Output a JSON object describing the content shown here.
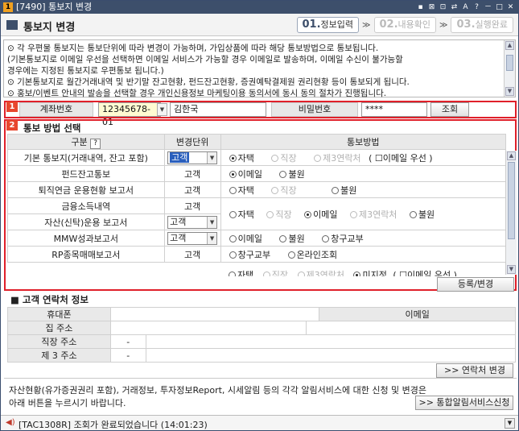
{
  "window": {
    "app_icon": "1",
    "title": "[7490] 통보지 변경",
    "controls": [
      "▪",
      "⊠",
      "⊡",
      "⇄",
      "A",
      "?",
      "－",
      "□",
      "✕"
    ]
  },
  "header": {
    "title": "통보지 변경",
    "steps": [
      {
        "num": "01.",
        "label": "정보입력",
        "active": true
      },
      {
        "num": "02.",
        "label": "내용확인",
        "active": false
      },
      {
        "num": "03.",
        "label": "실행완료",
        "active": false
      }
    ],
    "step_arrow": "≫"
  },
  "notice": {
    "lines": [
      "⊙ 각 우편물 통보지는 통보단위에 따라 변경이 가능하며, 가입상품에 따라 해당 통보방법으로 통보됩니다.",
      "   (기본통보지로 이메일 우선을 선택하면 이메일 서비스가 가능할 경우 이메일로 발송하며, 이메일 수신이 불가능할",
      "    경우에는 지정된 통보지로 우편통보 됩니다.)",
      "⊙ 기본통보지로 월간거래내역 및 반기말 잔고현황, 펀드잔고현황, 증권예탁결제원 권리현황 등이 통보되게 됩니다.",
      "⊙ 홍보/이벤트 안내의 발송을 선택할 경우 개인신용정보 마케팅이용 동의서에 동시 동의 절차가 진행됩니다."
    ]
  },
  "account": {
    "badge": "1",
    "account_label": "계좌번호",
    "account_number": "12345678-01",
    "owner_name": "김한국",
    "password_label": "비밀번호",
    "password_value": "****",
    "query_button": "조회"
  },
  "notify_section": {
    "badge": "2",
    "title": "통보 방법 선택",
    "columns": {
      "type": "구분",
      "help": "?",
      "unit": "변경단위",
      "method": "통보방법"
    },
    "rows": [
      {
        "name": "기본 통보지(거래내역, 잔고 포함)",
        "unit": "고객",
        "unit_select": true,
        "unit_highlight": true,
        "options": [
          {
            "label": "자택",
            "on": true,
            "dis": false
          },
          {
            "label": "직장",
            "on": false,
            "dis": true
          },
          {
            "label": "제3연락처",
            "on": false,
            "dis": true
          }
        ],
        "email_pref": "( ☐이메일 우선 )"
      },
      {
        "name": "펀드잔고통보",
        "unit": "고객",
        "unit_select": false,
        "options": [
          {
            "label": "이메일",
            "on": true,
            "dis": false
          },
          {
            "label": "불원",
            "on": false,
            "dis": false
          }
        ]
      },
      {
        "name": "퇴직연금 운용현황 보고서",
        "unit": "고객",
        "unit_select": false,
        "options": [
          {
            "label": "자택",
            "on": false,
            "dis": false
          },
          {
            "label": "직장",
            "on": false,
            "dis": true
          },
          {
            "label": "불원",
            "on": false,
            "dis": false
          }
        ]
      },
      {
        "name": "금융소득내역",
        "unit": "고객",
        "unit_select": false,
        "options": [
          {
            "label": "자택",
            "on": false,
            "dis": false
          },
          {
            "label": "직장",
            "on": false,
            "dis": true
          },
          {
            "label": "이메일",
            "on": true,
            "dis": false
          },
          {
            "label": "제3연락처",
            "on": false,
            "dis": true
          },
          {
            "label": "불원",
            "on": false,
            "dis": false
          }
        ]
      },
      {
        "name": "자산(신탁)운용 보고서",
        "unit": "고객",
        "unit_select": true,
        "options": []
      },
      {
        "name": "MMW성과보고서",
        "unit": "고객",
        "unit_select": true,
        "options": [
          {
            "label": "이메일",
            "on": false,
            "dis": false
          },
          {
            "label": "불원",
            "on": false,
            "dis": false
          },
          {
            "label": "창구교부",
            "on": false,
            "dis": false
          }
        ]
      },
      {
        "name": "RP종목매매보고서",
        "unit": "고객",
        "unit_select": false,
        "options": [
          {
            "label": "창구교부",
            "on": false,
            "dis": false
          },
          {
            "label": "온라인조회",
            "on": false,
            "dis": false
          }
        ]
      }
    ],
    "partial_row": {
      "a": "자택",
      "b": "직장",
      "c": "제3연락처",
      "d": "미지정",
      "e": "( ☐이메일 우선 )"
    },
    "register_button": "등록/변경"
  },
  "contact": {
    "title": "■ 고객 연락처 정보",
    "rows": [
      {
        "label": "휴대폰",
        "value": "",
        "col3_label": "이메일",
        "col3_value": ""
      },
      {
        "label": "집 주소",
        "value": "",
        "col3_label": "",
        "col3_value": ""
      },
      {
        "label": "직장 주소",
        "value": "-",
        "col3_label": "",
        "col3_value": ""
      },
      {
        "label": "제 3 주소",
        "value": "-",
        "col3_label": "",
        "col3_value": ""
      }
    ],
    "change_button": ">> 연락처 변경"
  },
  "bottom": {
    "line1": "자산현황(유가증권권리 포함), 거래정보, 투자정보Report, 시세알림 등의 각각 알림서비스에 대한 신청 및 변경은",
    "line2": "아래 버튼을 누르시기 바랍니다.",
    "button": ">> 통합알림서비스신청"
  },
  "status": {
    "text": "[TAC1308R] 조회가 완료되었습니다 (14:01:23)"
  },
  "colors": {
    "titlebar": "#3d4f6b",
    "highlight_border": "#e0202a",
    "badge": "#e8472e"
  }
}
